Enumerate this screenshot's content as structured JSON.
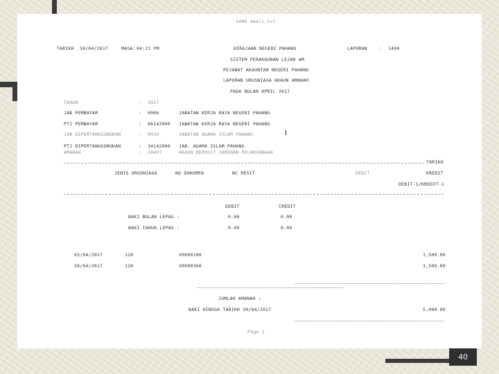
{
  "file_name": "1400 amali.txt",
  "header": {
    "tarikh_label": "TARIKH",
    "tarikh_value": "30/04/2017",
    "masa_label": "MASA:",
    "masa_value": "04:21 PM",
    "org": "KERAJAAN NEGERI  PAHANG",
    "laporan_label": "LAPORAN",
    "laporan_sep": ":",
    "laporan_value": "1400",
    "system": "SISTEM PERAKAUNAN LEJAR AM",
    "office": "PEJABAT AKAUNTAN NEGERI PAHANG",
    "report_title": "LAPORAN URUSNIAGA AKAUN AMANAH",
    "period": "PADA BULAN  APRIL 2017"
  },
  "info_rows": [
    {
      "label": "TAHUN",
      "value": "2017",
      "desc": ""
    },
    {
      "label": "JAB PEMBAYAR",
      "value": "0006",
      "desc": "JABATAN  KERJA RAYA NEGERI PAHANG"
    },
    {
      "label": "PTJ PEMBAYAR",
      "value": "06142000",
      "desc": "JABATAN KERJA RAYA NEGERI PAHANG"
    },
    {
      "label": "JAB DIPERTANGGUNGKAN",
      "value": "0034",
      "desc": "JABATAN  AGAMA ISLAM PAHANG"
    },
    {
      "label": "PTJ DIPERTANGGUNGKAN",
      "value": "34142000",
      "desc": "JAB. AGAMA ISLAM PAHANG"
    },
    {
      "label": "AMANAH",
      "value": "20497",
      "desc": "AKAUN DEPOSIT JAMINAN PELAKSANAAN"
    }
  ],
  "info_sep": ":",
  "right_tarikh": "TARIKH",
  "columns": {
    "jenis": "JENIS URUSNIAGA",
    "dokumen": "NO DOKUMEN",
    "resit": "NC RESIT",
    "debit": "DEBIT",
    "kredit": "KREDIT",
    "debit_kredit": "DEBIT-1/KREDIT-1"
  },
  "summary": {
    "debit_label": "DEBIT",
    "credit_label": "CREDIT",
    "rows": [
      {
        "label": "BAKI BULAN LEPAS :",
        "debit": "0.00",
        "credit": "0.00"
      },
      {
        "label": "BAKI TAHUN LEPAS :",
        "debit": "0.00",
        "credit": "0.00"
      }
    ]
  },
  "transactions": [
    {
      "date": "03/04/2017",
      "code": "120",
      "doc": "V0000100",
      "amount": "1,500.00"
    },
    {
      "date": "30/04/2017",
      "code": "120",
      "doc": "V0000360",
      "amount": "3,500.00"
    }
  ],
  "jumlah_label": "JUMLAH AMANAH :",
  "baki_label": "BAKI HINGGA TARIKH 30/04/2017",
  "baki_value": "5,000.00",
  "page_label": "Page 1",
  "slide_number": "40"
}
